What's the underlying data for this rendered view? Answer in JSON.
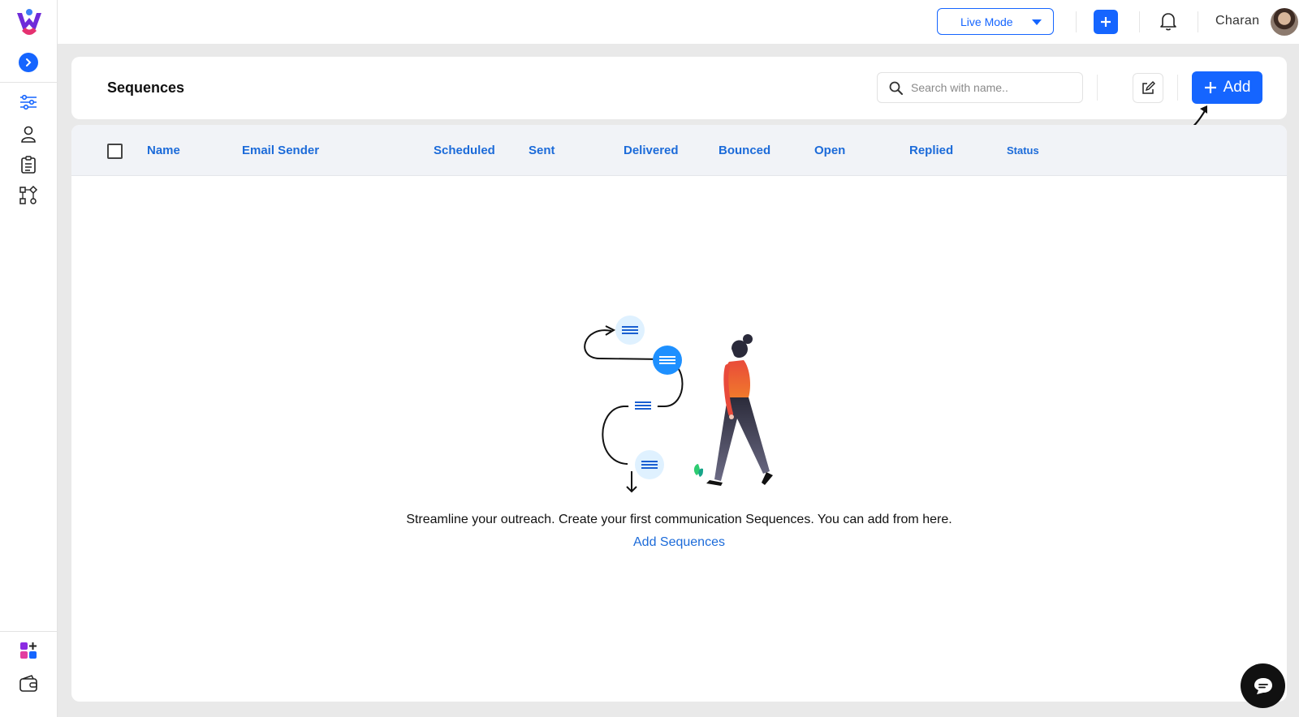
{
  "topbar": {
    "mode_label": "Live Mode",
    "user_name": "Charan"
  },
  "header": {
    "title": "Sequences",
    "search_placeholder": "Search with name..",
    "add_label": "Add"
  },
  "table": {
    "columns": [
      "Name",
      "Email Sender",
      "Scheduled",
      "Sent",
      "Delivered",
      "Bounced",
      "Open",
      "Replied",
      "Status"
    ]
  },
  "empty_state": {
    "message": "Streamline your outreach. Create your first communication Sequences. You can add from here.",
    "link_label": "Add Sequences"
  },
  "colors": {
    "accent": "#1565ff",
    "link": "#1c6bd9"
  }
}
